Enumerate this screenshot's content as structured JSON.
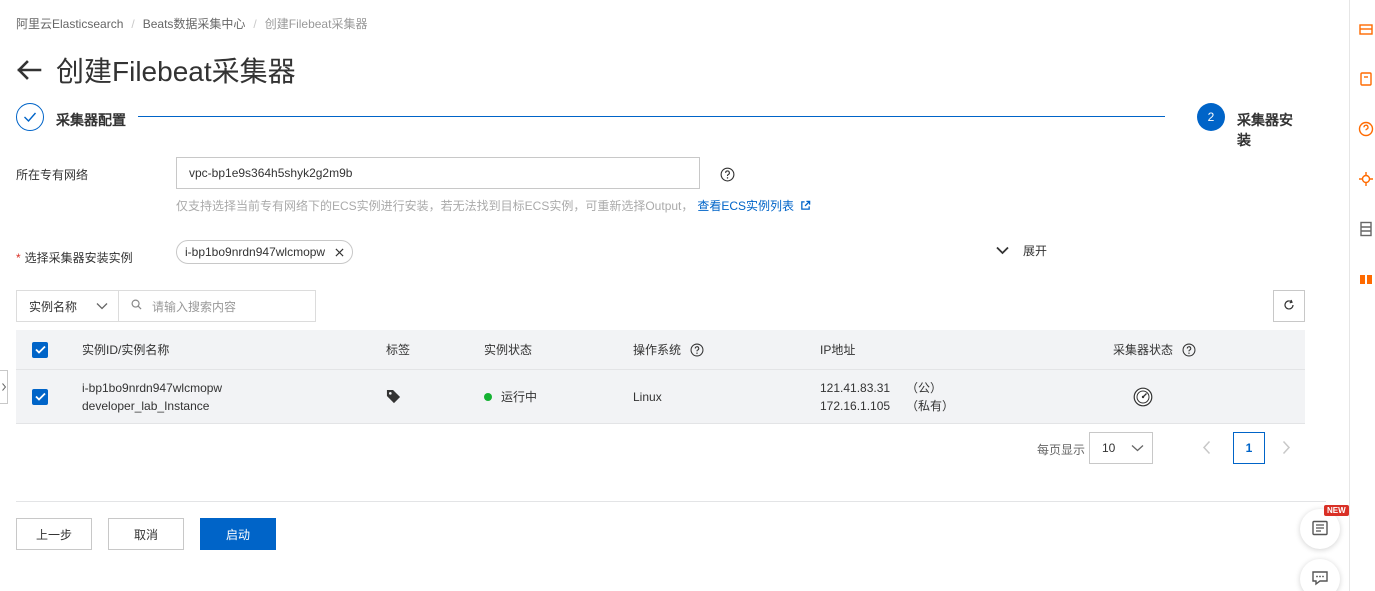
{
  "breadcrumb": {
    "items": [
      "阿里云Elasticsearch",
      "Beats数据采集中心"
    ],
    "current": "创建Filebeat采集器",
    "separator": "/"
  },
  "page": {
    "title": "创建Filebeat采集器"
  },
  "steps": [
    {
      "number": "1",
      "label": "采集器配置",
      "state": "done"
    },
    {
      "number": "2",
      "label": "采集器安装",
      "state": "active"
    }
  ],
  "form": {
    "vpc_label": "所在专有网络",
    "vpc_value": "vpc-bp1e9s364h5shyk2g2m9b",
    "hint_text": "仅支持选择当前专有网络下的ECS实例进行安装，若无法找到目标ECS实例，可重新选择Output，",
    "hint_link": "查看ECS实例列表",
    "instance_label": "选择采集器安装实例",
    "required_mark": "*",
    "selected_instance": "i-bp1bo9nrdn947wlcmopw",
    "expand_label": "展开"
  },
  "search": {
    "field": "实例名称",
    "placeholder": "请输入搜索内容"
  },
  "table": {
    "headers": {
      "id_name": "实例ID/实例名称",
      "tags": "标签",
      "status": "实例状态",
      "os": "操作系统",
      "ip": "IP地址",
      "collector_status": "采集器状态"
    },
    "rows": [
      {
        "instance_id": "i-bp1bo9nrdn947wlcmopw",
        "instance_name": "developer_lab_Instance",
        "status": "运行中",
        "os": "Linux",
        "public_ip": "121.41.83.31",
        "public_label": "（公）",
        "private_ip": "172.16.1.105",
        "private_label": "（私有）"
      }
    ]
  },
  "pagination": {
    "page_size_label": "每页显示",
    "page_size": "10",
    "current_page": "1"
  },
  "buttons": {
    "prev": "上一步",
    "cancel": "取消",
    "start": "启动"
  },
  "badges": {
    "new": "NEW"
  },
  "colors": {
    "primary": "#0064c8",
    "running": "#15b232",
    "accent_orange": "#ff6a00",
    "required": "#d93026"
  },
  "icons": {
    "right_rail": [
      "store-icon",
      "cart-icon",
      "help-icon",
      "bug-icon",
      "cabinet-icon",
      "gift-icon"
    ]
  }
}
